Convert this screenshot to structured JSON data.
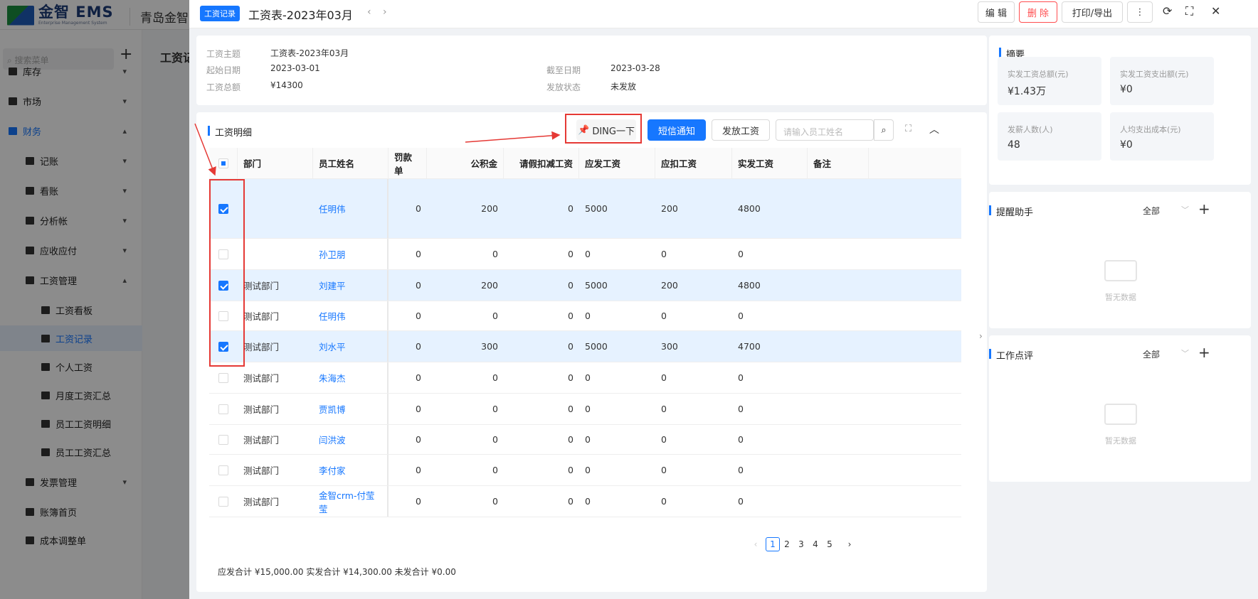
{
  "bg": {
    "logo_main": "金智 EMS",
    "logo_sub": "Enterprise Management System",
    "company": "青岛金智",
    "search_placeholder": "搜索菜单",
    "mid_heading": "工资记",
    "menu": [
      {
        "label": "库存",
        "arrow": "▾"
      },
      {
        "label": "市场",
        "arrow": "▾"
      },
      {
        "label": "财务",
        "arrow": "▴"
      },
      {
        "label": "记账",
        "arrow": "▾"
      },
      {
        "label": "看账",
        "arrow": "▾"
      },
      {
        "label": "分析帐",
        "arrow": "▾"
      },
      {
        "label": "应收应付",
        "arrow": "▾"
      },
      {
        "label": "工资管理",
        "arrow": "▴"
      },
      {
        "label": "工资看板"
      },
      {
        "label": "工资记录"
      },
      {
        "label": "个人工资"
      },
      {
        "label": "月度工资汇总"
      },
      {
        "label": "员工工资明细"
      },
      {
        "label": "员工工资汇总"
      },
      {
        "label": "发票管理",
        "arrow": "▾"
      },
      {
        "label": "账簿首页"
      },
      {
        "label": "成本调整单"
      }
    ]
  },
  "drawer": {
    "tag": "工资记录",
    "title": "工资表-2023年03月",
    "prev": "‹",
    "next": "›",
    "buttons": {
      "edit": "编 辑",
      "delete": "删 除",
      "print": "打印/导出",
      "more": "⋮"
    },
    "icons": {
      "refresh": "⟳",
      "fullscreen": "⛶",
      "close": "✕"
    }
  },
  "info": {
    "subject_label": "工资主题",
    "subject": "工资表-2023年03月",
    "start_label": "起始日期",
    "start": "2023-03-01",
    "end_label": "截至日期",
    "end": "2023-03-28",
    "total_label": "工资总额",
    "total": "¥14300",
    "status_label": "发放状态",
    "status": "未发放"
  },
  "detail": {
    "title": "工资明细",
    "ding": "DING一下",
    "sms": "短信通知",
    "pay": "发放工资",
    "search_placeholder": "请输入员工姓名",
    "columns": [
      "部门",
      "员工姓名",
      "罚款单",
      "公积金",
      "请假扣减工资",
      "应发工资",
      "应扣工资",
      "实发工资",
      "备注"
    ],
    "rows": [
      {
        "checked": true,
        "dept": "",
        "name": "任明伟",
        "fine": "0",
        "fund": "200",
        "leave": "0",
        "gross": "5000",
        "deduct": "200",
        "net": "4800"
      },
      {
        "checked": false,
        "dept": "",
        "name": "孙卫朋",
        "fine": "0",
        "fund": "0",
        "leave": "0",
        "gross": "0",
        "deduct": "0",
        "net": "0"
      },
      {
        "checked": true,
        "dept": "测试部门",
        "name": "刘建平",
        "fine": "0",
        "fund": "200",
        "leave": "0",
        "gross": "5000",
        "deduct": "200",
        "net": "4800"
      },
      {
        "checked": false,
        "dept": "测试部门",
        "name": "任明伟",
        "fine": "0",
        "fund": "0",
        "leave": "0",
        "gross": "0",
        "deduct": "0",
        "net": "0"
      },
      {
        "checked": true,
        "dept": "测试部门",
        "name": "刘水平",
        "fine": "0",
        "fund": "300",
        "leave": "0",
        "gross": "5000",
        "deduct": "300",
        "net": "4700"
      },
      {
        "checked": false,
        "dept": "测试部门",
        "name": "朱海杰",
        "fine": "0",
        "fund": "0",
        "leave": "0",
        "gross": "0",
        "deduct": "0",
        "net": "0"
      },
      {
        "checked": false,
        "dept": "测试部门",
        "name": "贾凯博",
        "fine": "0",
        "fund": "0",
        "leave": "0",
        "gross": "0",
        "deduct": "0",
        "net": "0"
      },
      {
        "checked": false,
        "dept": "测试部门",
        "name": "闫洪波",
        "fine": "0",
        "fund": "0",
        "leave": "0",
        "gross": "0",
        "deduct": "0",
        "net": "0"
      },
      {
        "checked": false,
        "dept": "测试部门",
        "name": "李付家",
        "fine": "0",
        "fund": "0",
        "leave": "0",
        "gross": "0",
        "deduct": "0",
        "net": "0"
      },
      {
        "checked": false,
        "dept": "测试部门",
        "name": "金智crm-付莹莹",
        "fine": "0",
        "fund": "0",
        "leave": "0",
        "gross": "0",
        "deduct": "0",
        "net": "0"
      }
    ],
    "pages": [
      "1",
      "2",
      "3",
      "4",
      "5"
    ],
    "current_page": "1",
    "footer": "应发合计 ¥15,000.00 实发合计 ¥14,300.00 未发合计 ¥0.00"
  },
  "summary": {
    "title": "摘要",
    "stats": [
      {
        "label": "实发工资总额(元)",
        "value": "¥1.43万"
      },
      {
        "label": "实发工资支出额(元)",
        "value": "¥0"
      },
      {
        "label": "发薪人数(人)",
        "value": "48"
      },
      {
        "label": "人均支出成本(元)",
        "value": "¥0"
      }
    ]
  },
  "reminder": {
    "title": "提醒助手",
    "filter": "全部",
    "empty": "暂无数据"
  },
  "review": {
    "title": "工作点评",
    "filter": "全部",
    "empty": "暂无数据"
  }
}
